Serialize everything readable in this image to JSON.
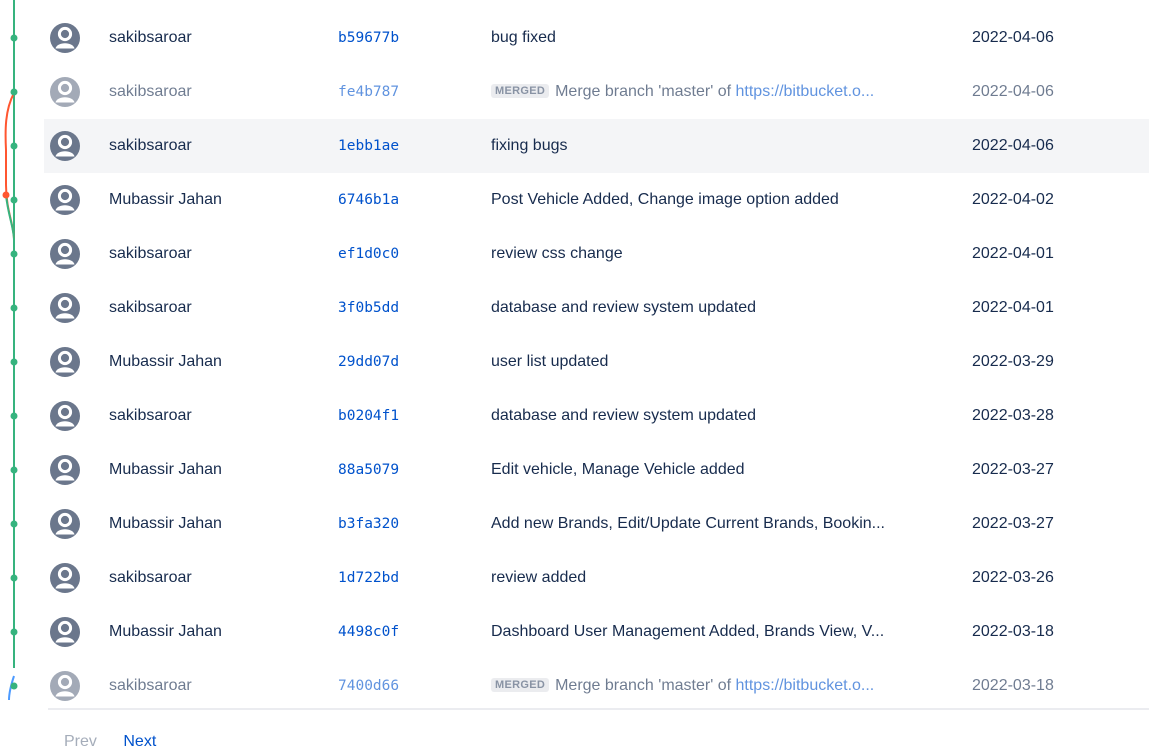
{
  "colors": {
    "graph_main": "#36b37e",
    "graph_branch": "#ff5630",
    "graph_bottom": "#4c9aff",
    "link": "#0052cc",
    "row_hover": "#f4f5f7"
  },
  "icons": {
    "avatar": "default-user-avatar-icon"
  },
  "commits": [
    {
      "author": "sakibsaroar",
      "hash": "b59677b",
      "message": "bug fixed",
      "date": "2022-04-06"
    },
    {
      "author": "sakibsaroar",
      "hash": "fe4b787",
      "badge": "MERGED",
      "message": "Merge branch 'master' of ",
      "link": "https://bitbucket.o...",
      "date": "2022-04-06"
    },
    {
      "author": "sakibsaroar",
      "hash": "1ebb1ae",
      "message": "fixing bugs",
      "date": "2022-04-06"
    },
    {
      "author": "Mubassir Jahan",
      "hash": "6746b1a",
      "message": "Post Vehicle Added, Change image option added",
      "date": "2022-04-02"
    },
    {
      "author": "sakibsaroar",
      "hash": "ef1d0c0",
      "message": "review css change",
      "date": "2022-04-01"
    },
    {
      "author": "sakibsaroar",
      "hash": "3f0b5dd",
      "message": "database and review system updated",
      "date": "2022-04-01"
    },
    {
      "author": "Mubassir Jahan",
      "hash": "29dd07d",
      "message": "user list updated",
      "date": "2022-03-29"
    },
    {
      "author": "sakibsaroar",
      "hash": "b0204f1",
      "message": "database and review system updated",
      "date": "2022-03-28"
    },
    {
      "author": "Mubassir Jahan",
      "hash": "88a5079",
      "message": "Edit vehicle, Manage Vehicle added",
      "date": "2022-03-27"
    },
    {
      "author": "Mubassir Jahan",
      "hash": "b3fa320",
      "message": "Add new Brands, Edit/Update Current Brands, Bookin...",
      "date": "2022-03-27"
    },
    {
      "author": "sakibsaroar",
      "hash": "1d722bd",
      "message": "review added",
      "date": "2022-03-26"
    },
    {
      "author": "Mubassir Jahan",
      "hash": "4498c0f",
      "message": "Dashboard User Management Added, Brands View, V...",
      "date": "2022-03-18"
    },
    {
      "author": "sakibsaroar",
      "hash": "7400d66",
      "badge": "MERGED",
      "message": "Merge branch 'master' of ",
      "link": "https://bitbucket.o...",
      "date": "2022-03-18"
    }
  ],
  "pagination": {
    "prev": "Prev",
    "next": "Next"
  }
}
